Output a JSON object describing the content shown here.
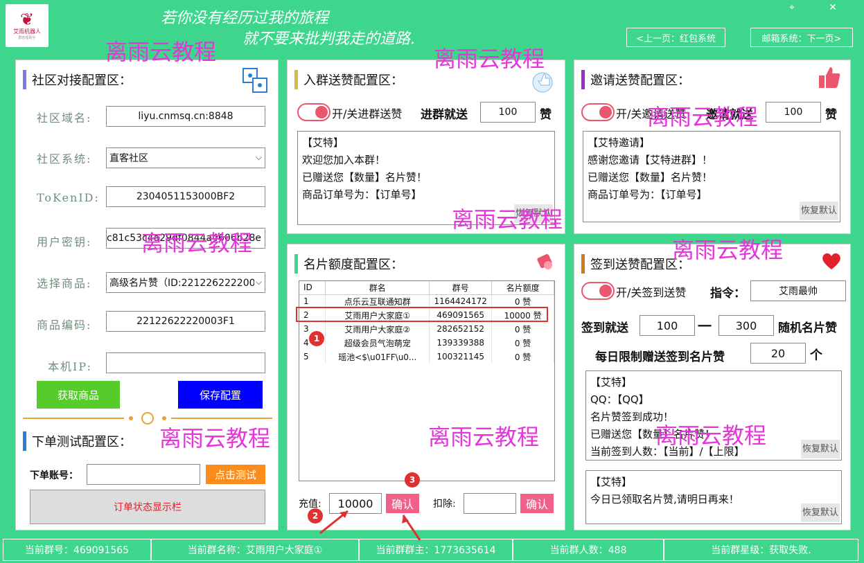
{
  "header": {
    "logo_title": "艾雨机器人",
    "logo_subtitle": "群管理助手",
    "slogan_line1": "若你没有经历过我的旅程",
    "slogan_line2": "就不要来批判我走的道路.",
    "prev_button": "<上一页：红包系统",
    "next_button": "邮箱系统：下一页>",
    "settings_icon": "⌖",
    "close_icon": "✕"
  },
  "community": {
    "title": "社区对接配置区：",
    "domain_label": "社区域名:",
    "domain_value": "liyu.cnmsq.cn:8848",
    "system_label": "社区系统:",
    "system_value": "直客社区",
    "token_label": "ToKenID:",
    "token_value": "2304051153000BF2",
    "key_label": "用户密钥:",
    "key_value": "c81c53c4a29df0844a4606b28e",
    "product_label": "选择商品:",
    "product_value": "高级名片赞（ID:221226222200",
    "code_label": "商品编码:",
    "code_value": "22122622220003F1",
    "ip_label": "本机IP:",
    "ip_value": "",
    "get_button": "获取商品",
    "save_button": "保存配置"
  },
  "order_test": {
    "title": "下单测试配置区：",
    "account_label": "下单账号：",
    "account_value": "",
    "test_button": "点击测试",
    "status_button": "订单状态显示栏"
  },
  "join": {
    "title": "入群送赞配置区：",
    "toggle_label": "开/关进群送赞",
    "send_label": "进群就送",
    "send_value": "100",
    "unit": "赞",
    "message": [
      "【艾特】",
      "欢迎您加入本群！",
      "已赠送您【数量】名片赞！",
      "商品订单号为：【订单号】"
    ],
    "restore": "恢复默认"
  },
  "invite": {
    "title": "邀请送赞配置区：",
    "toggle_label": "开/关邀请送赞",
    "send_label": "邀请就送",
    "send_value": "100",
    "unit": "赞",
    "message": [
      "【艾特邀请】",
      "感谢您邀请【艾特进群】！",
      "已赠送您【数量】名片赞！",
      "商品订单号为：【订单号】"
    ],
    "restore": "恢复默认"
  },
  "quota": {
    "title": "名片额度配置区：",
    "columns": [
      "ID",
      "群名",
      "群号",
      "名片额度"
    ],
    "rows": [
      {
        "id": "1",
        "name": "点乐云互联通知群",
        "number": "1164424172",
        "quota": "0 赞"
      },
      {
        "id": "2",
        "name": "艾雨用户大家庭①",
        "number": "469091565",
        "quota": "10000 赞"
      },
      {
        "id": "3",
        "name": "艾雨用户大家庭②",
        "number": "282652152",
        "quota": "0 赞"
      },
      {
        "id": "4",
        "name": "超级会员气泡萌宠",
        "number": "139339388",
        "quota": "0 赞"
      },
      {
        "id": "5",
        "name": "瑶池<$\\u01FF\\u0...",
        "number": "100321145",
        "quota": "0 赞"
      }
    ],
    "charge_label": "充值:",
    "charge_value": "10000",
    "confirm": "确认",
    "deduct_label": "扣除:",
    "deduct_value": "",
    "confirm2": "确认"
  },
  "signin": {
    "title": "签到送赞配置区：",
    "toggle_label": "开/关签到送赞",
    "command_label": "指令：",
    "command_value": "艾雨最帅",
    "range_label": "签到就送",
    "range_min": "100",
    "dash": "一",
    "range_max": "300",
    "random_label": "随机名片赞",
    "limit_label": "每日限制赠送签到名片赞",
    "limit_value": "20",
    "limit_unit": "个",
    "message": [
      "【艾特】",
      "QQ：【QQ】",
      "名片赞签到成功！",
      "已赠送您【数量】名片赞！",
      "当前签到人数：【当前】/【上限】"
    ],
    "message2": [
      "【艾特】",
      "今日已领取名片赞,请明日再来！"
    ],
    "restore": "恢复默认",
    "restore2": "恢复默认"
  },
  "status_bar": {
    "group_number": "当前群号：469091565",
    "group_name": "当前群名称：艾雨用户大家庭①",
    "group_owner": "当前群群主：1773635614",
    "group_members": "当前群人数：488",
    "group_level": "当前群星级：获取失败."
  },
  "watermark": "离雨云教程",
  "annotations": [
    "1",
    "2",
    "3"
  ],
  "colors": {
    "brand": "#3dd68c",
    "accent_red": "#e9566d",
    "green_button": "#55cc2a",
    "blue_button": "#0000ff",
    "orange_button": "#fb8c1c"
  }
}
